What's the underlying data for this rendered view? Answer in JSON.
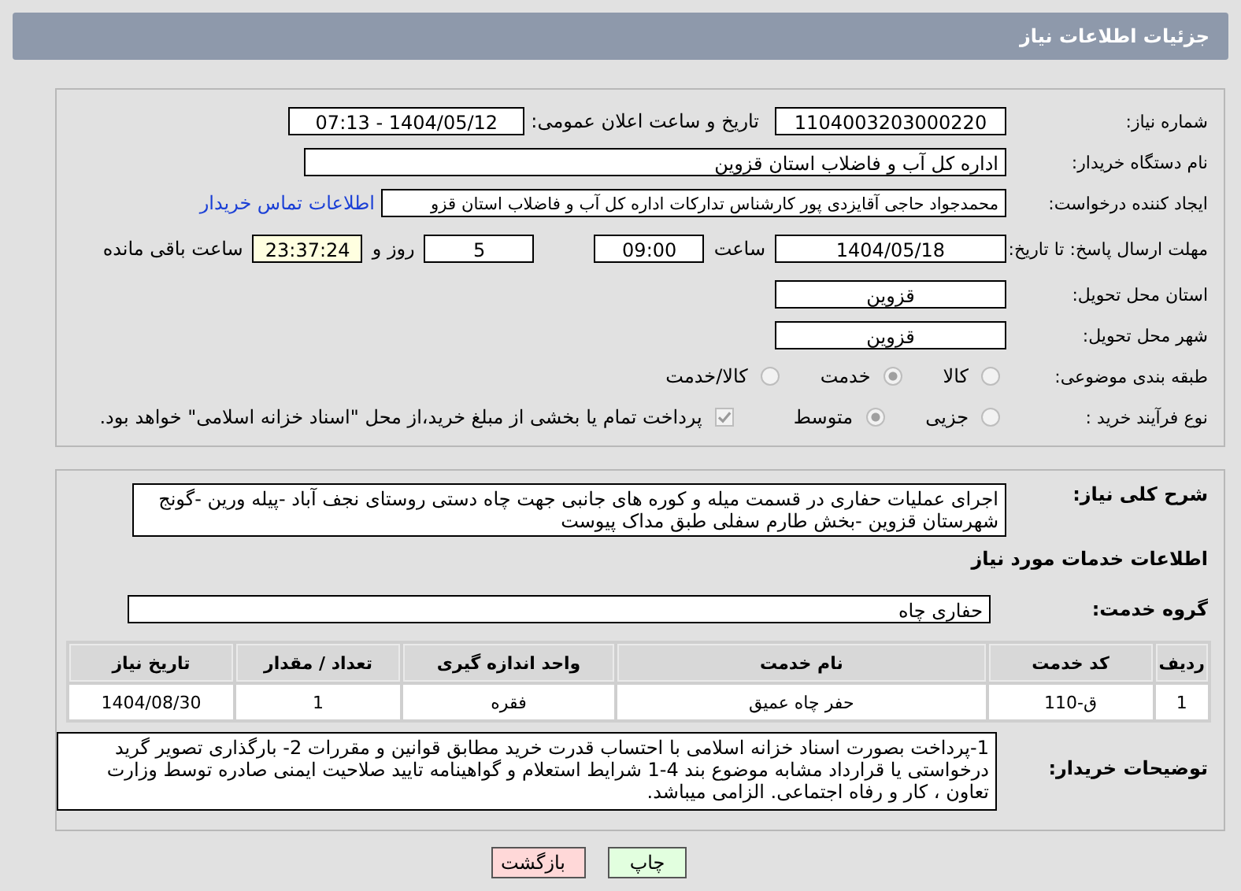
{
  "window": {
    "title": "جزئیات اطلاعات نیاز"
  },
  "need_number": {
    "label": "شماره نیاز:",
    "value": "1104003203000220"
  },
  "announce": {
    "label": "تاریخ و ساعت اعلان عمومی:",
    "value": "1404/05/12 - 07:13"
  },
  "buyer_org": {
    "label": "نام دستگاه خریدار:",
    "value": "اداره کل آب و فاضلاب استان قزوین"
  },
  "requester": {
    "label": "ایجاد کننده درخواست:",
    "value": "محمدجواد حاجی آقایزدی پور کارشناس تدارکات اداره کل آب و فاضلاب استان قزو",
    "link": "اطلاعات تماس خریدار"
  },
  "deadline": {
    "label": "مهلت ارسال پاسخ: تا تاریخ:",
    "date": "1404/05/18",
    "time_label": "ساعت",
    "time": "09:00",
    "days": "5",
    "days_label": "روز و",
    "remaining": "23:37:24",
    "remaining_label": "ساعت باقی مانده"
  },
  "province": {
    "label": "استان محل تحویل:",
    "value": "قزوین"
  },
  "city": {
    "label": "شهر محل تحویل:",
    "value": "قزوین"
  },
  "category": {
    "label": "طبقه بندی موضوعی:",
    "options": [
      {
        "label": "کالا",
        "selected": false
      },
      {
        "label": "خدمت",
        "selected": true
      },
      {
        "label": "کالا/خدمت",
        "selected": false
      }
    ]
  },
  "process": {
    "label": "نوع فرآیند خرید :",
    "options": [
      {
        "label": "جزیی",
        "selected": false
      },
      {
        "label": "متوسط",
        "selected": true
      }
    ],
    "payment": {
      "checked": true,
      "text": "پرداخت تمام یا بخشی از مبلغ خرید،از محل \"اسناد خزانه اسلامی\" خواهد بود."
    }
  },
  "description": {
    "label": "شرح کلی نیاز:",
    "value": "اجرای عملیات حفاری در قسمت میله و کوره های جانبی  جهت چاه دستی روستای نجف آباد -پیله ورین -گونج شهرستان قزوین -بخش طارم سفلی طبق مداک پیوست"
  },
  "services_heading": "اطلاعات خدمات مورد نیاز",
  "service_group": {
    "label": "گروه خدمت:",
    "value": "حفاری چاه"
  },
  "table": {
    "columns": [
      "ردیف",
      "کد خدمت",
      "نام خدمت",
      "واحد اندازه گیری",
      "تعداد / مقدار",
      "تاریخ نیاز"
    ],
    "rows": [
      [
        "1",
        "ق-110",
        "حفر چاه عمیق",
        "فقره",
        "1",
        "1404/08/30"
      ]
    ]
  },
  "buyer_notes": {
    "label": "توضیحات خریدار:",
    "value": "1-پرداخت بصورت اسناد خزانه اسلامی با احتساب قدرت خرید مطابق قوانین و مقررات 2- بارگذاری تصویر گرید درخواستی یا قرارداد مشابه موضوع بند 4-1 شرایط استعلام و گواهینامه تایید صلاحیت ایمنی صادره توسط وزارت تعاون ، کار و رفاه اجتماعی. الزامی میباشد."
  },
  "buttons": [
    {
      "label": "چاپ",
      "kind": "print"
    },
    {
      "label": "بازگشت",
      "kind": "back"
    }
  ]
}
